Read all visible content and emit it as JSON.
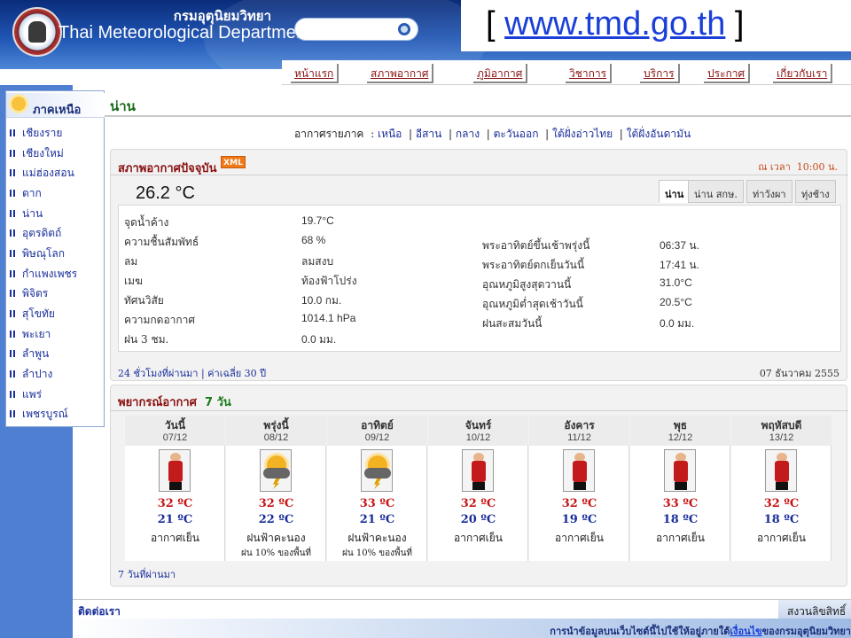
{
  "header": {
    "dept_thai": "กรมอุตุนิยมวิทยา",
    "dept_en": "Thai Meteorological Department",
    "search_placeholder": "",
    "url_open": "[ ",
    "url": "www.tmd.go.th",
    "url_close": " ]"
  },
  "nav": {
    "items": [
      {
        "label": "หน้าแรก"
      },
      {
        "label": "สภาพอากาศ"
      },
      {
        "label": "ภูมิอากาศ"
      },
      {
        "label": "วิชาการ"
      },
      {
        "label": "บริการ"
      },
      {
        "label": "ประกาศ"
      },
      {
        "label": "เกี่ยวกับเรา"
      }
    ]
  },
  "sidebar": {
    "title": "ภาคเหนือ",
    "items": [
      {
        "label": "เชียงราย"
      },
      {
        "label": "เชียงใหม่"
      },
      {
        "label": "แม่ฮ่องสอน"
      },
      {
        "label": "ตาก"
      },
      {
        "label": "น่าน"
      },
      {
        "label": "อุตรดิตถ์"
      },
      {
        "label": "พิษณุโลก"
      },
      {
        "label": "กำแพงเพชร"
      },
      {
        "label": "พิจิตร"
      },
      {
        "label": "สุโขทัย"
      },
      {
        "label": "พะเยา"
      },
      {
        "label": "ลำพูน"
      },
      {
        "label": "ลำปาง"
      },
      {
        "label": "แพร่"
      },
      {
        "label": "เพชรบูรณ์"
      }
    ]
  },
  "main": {
    "province": "น่าน",
    "regional": {
      "label": "อากาศรายภาค",
      "links": [
        "เหนือ",
        "อีสาน",
        "กลาง",
        "ตะวันออก",
        "ใต้ฝั่งอ่าวไทย",
        "ใต้ฝั่งอันดามัน"
      ]
    }
  },
  "current": {
    "header": "สภาพอากาศปัจจุบัน",
    "xml_badge": "XML",
    "time_prefix": "ณ  เวลา",
    "time": "10:00 น.",
    "temperature": "26.2 °C",
    "station_tabs": [
      "น่าน",
      "น่าน  สกษ.",
      "ท่าวังผา",
      "ทุ่งช้าง"
    ],
    "left_obs": [
      {
        "label": "จุดน้ำค้าง",
        "value": "19.7°C"
      },
      {
        "label": "ความชื้นสัมพัทธ์",
        "value": "68 %"
      },
      {
        "label": "ลม",
        "value": "ลมสงบ"
      },
      {
        "label": "เมฆ",
        "value": "ท้องฟ้าโปร่ง"
      },
      {
        "label": "ทัศนวิสัย",
        "value": "10.0 กม."
      },
      {
        "label": "ความกดอากาศ",
        "value": "1014.1 hPa"
      },
      {
        "label": "ฝน   3 ชม.",
        "value": "0.0 มม."
      }
    ],
    "right_obs": [
      {
        "label": "พระอาทิตย์ขึ้นเช้าพรุ่งนี้",
        "value": "06:37 น."
      },
      {
        "label": "พระอาทิตย์ตกเย็นวันนี้",
        "value": "17:41 น."
      },
      {
        "label": "อุณหภูมิสูงสุดวานนี้",
        "value": "31.0°C"
      },
      {
        "label": "อุณหภูมิต่ำสุดเช้าวันนี้",
        "value": "20.5°C"
      },
      {
        "label": "ฝนสะสมวันนี้",
        "value": "0.0 มม."
      }
    ],
    "footer_left": "24 ชั่วโมงที่ผ่านมา | ค่าเฉลี่ย  30 ปี",
    "footer_date": "07 ธันวาคม  2555"
  },
  "forecast": {
    "title": "พยากรณ์อากาศ",
    "days_label": "7 วัน",
    "days": [
      {
        "name": "วันนี้",
        "date": "07/12",
        "icon": "cold-person-icon",
        "max": "32 ºC",
        "min": "21 ºC",
        "cond": "อากาศเย็น",
        "rain": ""
      },
      {
        "name": "พรุ่งนี้",
        "date": "08/12",
        "icon": "thunderstorm-icon",
        "max": "32 ºC",
        "min": "22 ºC",
        "cond": "ฝนฟ้าคะนอง",
        "rain": "ฝน   10% ของพื้นที่"
      },
      {
        "name": "อาทิตย์",
        "date": "09/12",
        "icon": "thunderstorm-icon",
        "max": "33 ºC",
        "min": "21 ºC",
        "cond": "ฝนฟ้าคะนอง",
        "rain": "ฝน   10% ของพื้นที่"
      },
      {
        "name": "จันทร์",
        "date": "10/12",
        "icon": "cold-person-icon",
        "max": "32 ºC",
        "min": "20 ºC",
        "cond": "อากาศเย็น",
        "rain": ""
      },
      {
        "name": "อังคาร",
        "date": "11/12",
        "icon": "cold-person-icon",
        "max": "32 ºC",
        "min": "19 ºC",
        "cond": "อากาศเย็น",
        "rain": ""
      },
      {
        "name": "พุธ",
        "date": "12/12",
        "icon": "cold-person-icon",
        "max": "33 ºC",
        "min": "18 ºC",
        "cond": "อากาศเย็น",
        "rain": ""
      },
      {
        "name": "พฤหัสบดี",
        "date": "13/12",
        "icon": "cold-person-icon",
        "max": "32 ºC",
        "min": "18 ºC",
        "cond": "อากาศเย็น",
        "rain": ""
      }
    ],
    "past_link": "7 วันที่ผ่านมา"
  },
  "footer": {
    "contact": "ติดต่อเรา",
    "copyright": "สงวนลิขสิทธิ์",
    "note_prefix": "การนำข้อมูลบนเว็บไซต์นี้ไปใช้ให้อยู่ภายใต้",
    "note_link": "เงื่อนไข",
    "note_suffix": "ของกรมอุตุนิยมวิทยา"
  }
}
